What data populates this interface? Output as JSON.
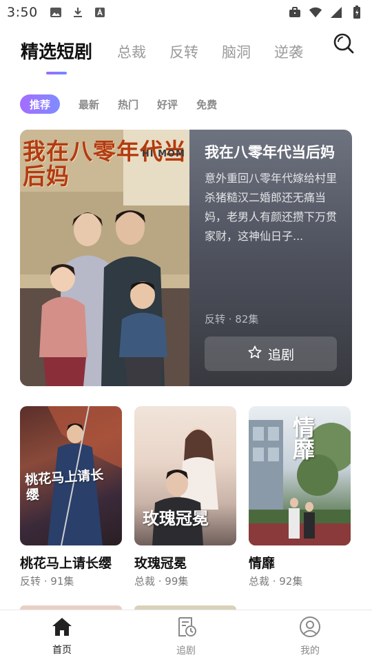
{
  "status_bar": {
    "time": "3:50",
    "left_icons": [
      "image-icon",
      "download-icon",
      "font-app-icon"
    ],
    "right_icons": [
      "briefcase-icon",
      "wifi-icon",
      "signal-icon",
      "battery-icon"
    ]
  },
  "top_tabs": [
    {
      "label": "精选短剧",
      "active": true
    },
    {
      "label": "总裁",
      "active": false
    },
    {
      "label": "反转",
      "active": false
    },
    {
      "label": "脑洞",
      "active": false
    },
    {
      "label": "逆袭",
      "active": false
    }
  ],
  "filters": [
    {
      "label": "推荐",
      "active": true
    },
    {
      "label": "最新",
      "active": false
    },
    {
      "label": "热门",
      "active": false
    },
    {
      "label": "好评",
      "active": false
    },
    {
      "label": "免费",
      "active": false
    }
  ],
  "featured": {
    "poster_title_art": "我在八零年代当后妈",
    "poster_sub": "HI MOM",
    "title": "我在八零年代当后妈",
    "description": "意外重回八零年代嫁给村里杀猪糙汉二婚郎还无痛当妈，老男人有颜还攒下万贯家财，这神仙日子...",
    "meta": "反转 · 82集",
    "follow_label": "追剧"
  },
  "cards": [
    {
      "title": "桃花马上请长缨",
      "meta": "反转 · 91集",
      "poster_art": "桃花马上请长缨"
    },
    {
      "title": "玫瑰冠冕",
      "meta": "总裁 · 99集",
      "poster_art": "玫瑰冠冕"
    },
    {
      "title": "情靡",
      "meta": "总裁 · 92集",
      "poster_art": "情靡"
    }
  ],
  "bottom_nav": [
    {
      "label": "首页",
      "icon": "home-icon",
      "active": true
    },
    {
      "label": "追剧",
      "icon": "watchlist-icon",
      "active": false
    },
    {
      "label": "我的",
      "icon": "profile-icon",
      "active": false
    }
  ],
  "colors": {
    "accent_gradient_start": "#a56cff",
    "accent_gradient_end": "#7f8cff",
    "featured_bg": "#505460"
  }
}
